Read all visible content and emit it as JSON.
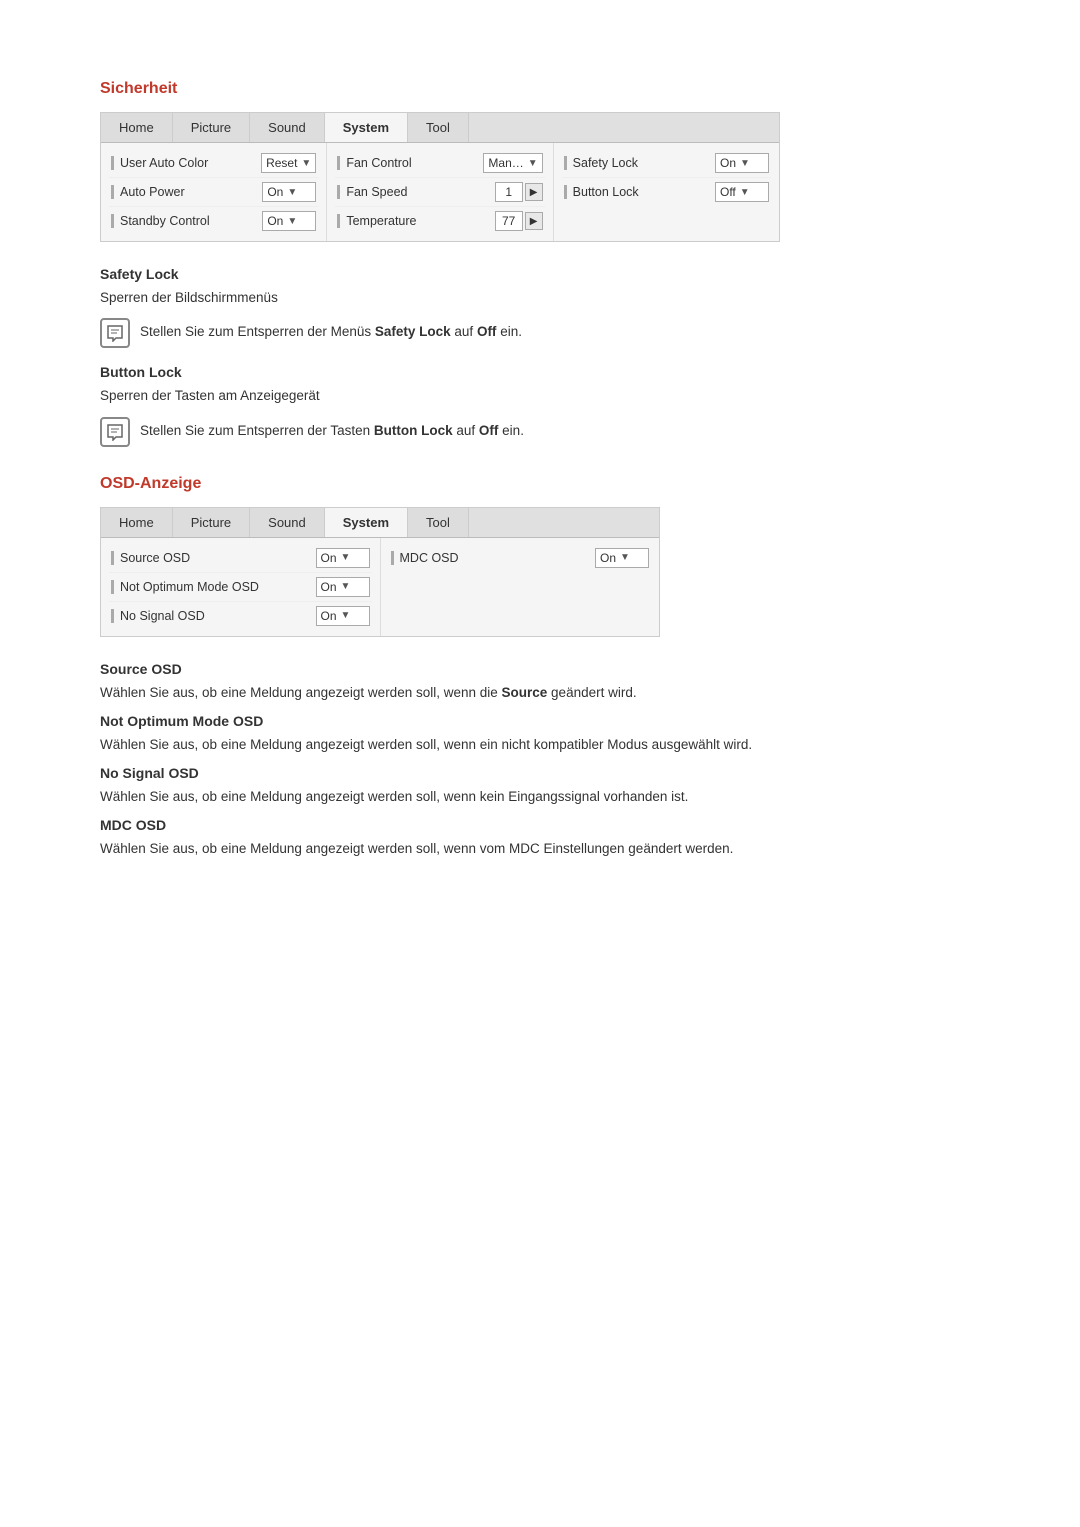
{
  "sicherheit": {
    "title": "Sicherheit",
    "table": {
      "tabs": [
        "Home",
        "Picture",
        "Sound",
        "System",
        "Tool"
      ],
      "active_tab": "System",
      "columns": [
        {
          "rows": [
            {
              "label": "User Auto Color",
              "control_type": "dropdown",
              "value": "Reset"
            },
            {
              "label": "Auto Power",
              "control_type": "dropdown",
              "value": "On"
            },
            {
              "label": "Standby Control",
              "control_type": "dropdown",
              "value": "On"
            }
          ]
        },
        {
          "rows": [
            {
              "label": "Fan Control",
              "control_type": "dropdown",
              "value": "Man…"
            },
            {
              "label": "Fan Speed",
              "control_type": "nav",
              "value": "1"
            },
            {
              "label": "Temperature",
              "control_type": "nav",
              "value": "77"
            }
          ]
        },
        {
          "rows": [
            {
              "label": "Safety Lock",
              "control_type": "dropdown",
              "value": "On"
            },
            {
              "label": "Button Lock",
              "control_type": "dropdown",
              "value": "Off"
            }
          ]
        }
      ]
    }
  },
  "safety_lock": {
    "title": "Safety Lock",
    "desc": "Sperren der Bildschirmmenüs",
    "note": "Stellen Sie zum Entsperren der Menüs Safety Lock auf Off ein.",
    "bold_part1": "Safety Lock",
    "bold_part2": "Off"
  },
  "button_lock": {
    "title": "Button Lock",
    "desc": "Sperren der Tasten am Anzeigegerät",
    "note": "Stellen Sie zum Entsperren der Tasten Button Lock auf Off ein.",
    "bold_part1": "Button Lock",
    "bold_part2": "Off"
  },
  "osd_anzeige": {
    "title": "OSD-Anzeige",
    "table": {
      "tabs": [
        "Home",
        "Picture",
        "Sound",
        "System",
        "Tool"
      ],
      "active_tab": "System",
      "columns": [
        {
          "rows": [
            {
              "label": "Source OSD",
              "control_type": "dropdown",
              "value": "On"
            },
            {
              "label": "Not Optimum Mode OSD",
              "control_type": "dropdown",
              "value": "On"
            },
            {
              "label": "No Signal OSD",
              "control_type": "dropdown",
              "value": "On"
            }
          ]
        },
        {
          "rows": [
            {
              "label": "MDC OSD",
              "control_type": "dropdown",
              "value": "On"
            }
          ]
        }
      ]
    }
  },
  "source_osd": {
    "title": "Source OSD",
    "desc": "Wählen Sie aus, ob eine Meldung angezeigt werden soll, wenn die Source geändert wird.",
    "bold": "Source"
  },
  "not_optimum": {
    "title": "Not Optimum Mode OSD",
    "desc": "Wählen Sie aus, ob eine Meldung angezeigt werden soll, wenn ein nicht kompatibler Modus ausgewählt wird."
  },
  "no_signal": {
    "title": "No Signal OSD",
    "desc": "Wählen Sie aus, ob eine Meldung angezeigt werden soll, wenn kein Eingangssignal vorhanden ist."
  },
  "mdc_osd": {
    "title": "MDC OSD",
    "desc": "Wählen Sie aus, ob eine Meldung angezeigt werden soll, wenn vom MDC Einstellungen geändert werden."
  }
}
